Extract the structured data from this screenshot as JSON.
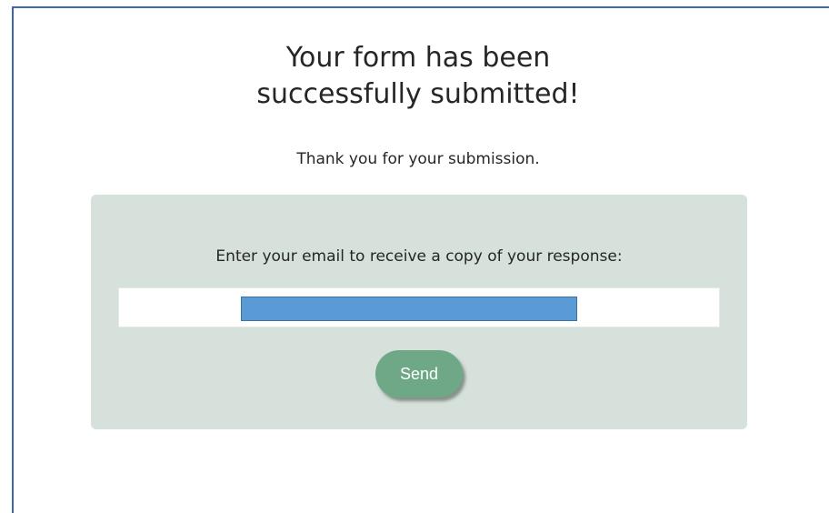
{
  "confirmation": {
    "title_line1": "Your form has been",
    "title_line2": "successfully submitted!",
    "message": "Thank you for your submission."
  },
  "email_copy": {
    "prompt": "Enter your email to receive a copy of your response:",
    "email_value": "",
    "send_label": "Send"
  },
  "colors": {
    "panel_background": "#d5e1da",
    "send_button": "#6fa887",
    "frame_border": "#3f66a8",
    "redaction": "#5b9bd5"
  }
}
